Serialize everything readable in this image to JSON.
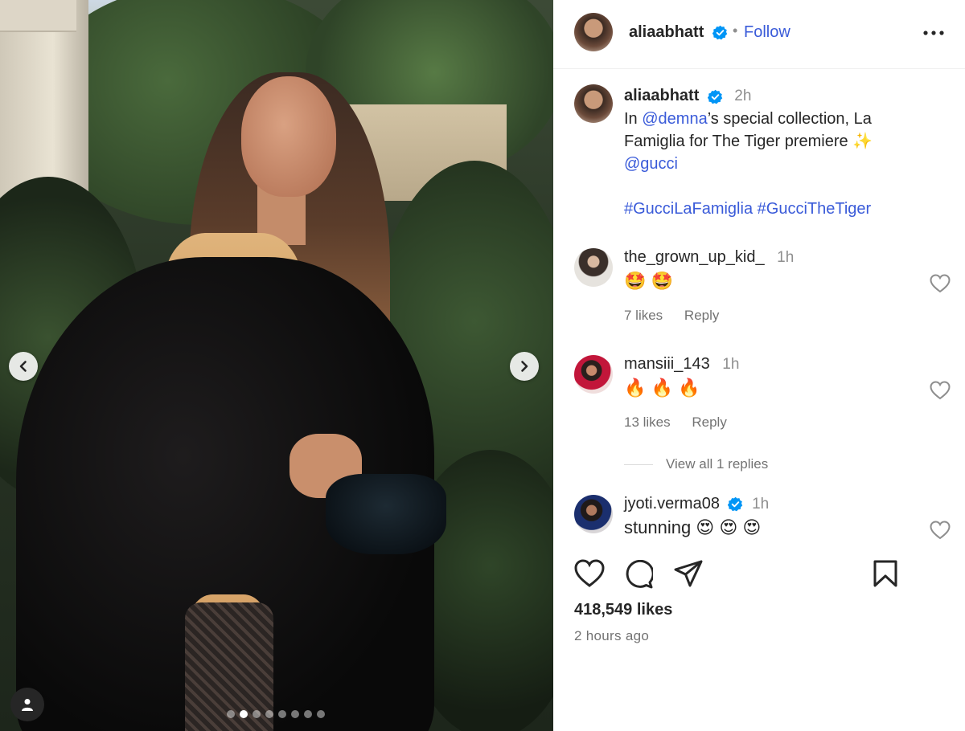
{
  "post": {
    "author": "aliaabhatt",
    "follow_label": "Follow",
    "separator": "•",
    "caption": {
      "username": "aliaabhatt",
      "time": "2h",
      "text_part1": "In ",
      "mention1": "@demna",
      "text_part2": "’s special collection, La Famiglia for The Tiger premiere ✨ ",
      "mention2": "@gucci",
      "hashtag1": "#GucciLaFamiglia",
      "hashtag2": "#GucciTheTiger"
    },
    "likes": "418,549 likes",
    "time_ago": "2 hours ago",
    "carousel": {
      "total": 8,
      "active_index": 1
    }
  },
  "comments": [
    {
      "username": "the_grown_up_kid_",
      "time": "1h",
      "text": "🤩 🤩",
      "likes": "7 likes",
      "reply": "Reply",
      "verified": false
    },
    {
      "username": "mansiii_143",
      "time": "1h",
      "text": "🔥 🔥 🔥",
      "likes": "13 likes",
      "reply": "Reply",
      "verified": false
    },
    {
      "username": "jyoti.verma08",
      "time": "1h",
      "text": "stunning 😍 😍 😍",
      "verified": true
    }
  ],
  "view_replies": "View all 1 replies",
  "colors": {
    "link": "#3a5bd9",
    "verified": "#0095f6",
    "muted": "#737373"
  },
  "icons": [
    "verified-badge-icon",
    "more-options-icon",
    "heart-icon",
    "comment-icon",
    "share-icon",
    "bookmark-icon",
    "chevron-left-icon",
    "chevron-right-icon",
    "user-tag-icon"
  ]
}
